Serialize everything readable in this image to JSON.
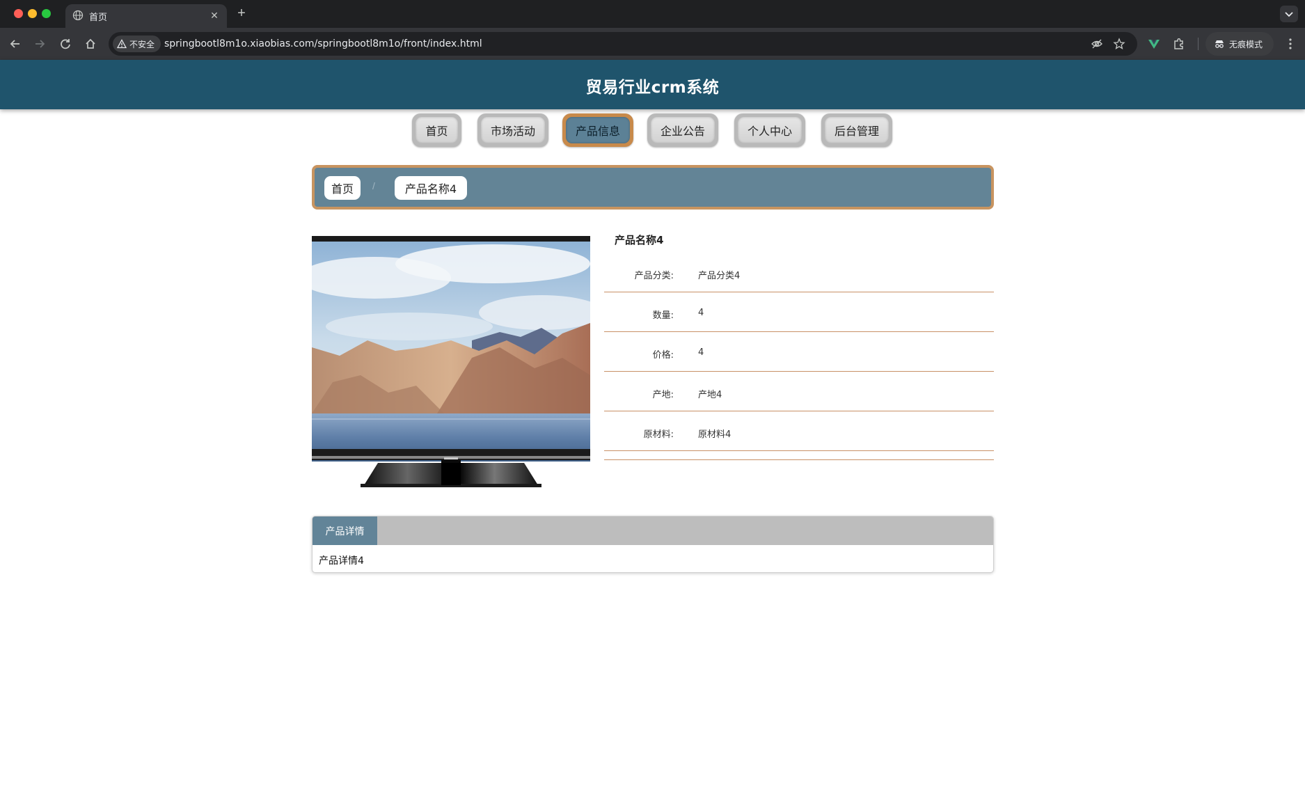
{
  "browser": {
    "tab_title": "首页",
    "security_label": "不安全",
    "url": "springbootl8m1o.xiaobias.com/springbootl8m1o/front/index.html",
    "incognito_label": "无痕模式"
  },
  "site": {
    "title": "贸易行业crm系统"
  },
  "nav": {
    "items": [
      {
        "label": "首页"
      },
      {
        "label": "市场活动"
      },
      {
        "label": "产品信息"
      },
      {
        "label": "企业公告"
      },
      {
        "label": "个人中心"
      },
      {
        "label": "后台管理"
      }
    ],
    "active": "产品信息"
  },
  "breadcrumb": {
    "home": "首页",
    "separator": "/",
    "current": "产品名称4"
  },
  "product": {
    "name": "产品名称4",
    "fields": [
      {
        "label": "产品分类:",
        "value": "产品分类4"
      },
      {
        "label": "数量:",
        "value": "4"
      },
      {
        "label": "价格:",
        "value": "4"
      },
      {
        "label": "产地:",
        "value": "产地4"
      },
      {
        "label": "原材料:",
        "value": "原材料4"
      }
    ]
  },
  "detail": {
    "tab_label": "产品详情",
    "content": "产品详情4"
  },
  "colors": {
    "header": "#1f546c",
    "accent_orange": "#c89460",
    "breadcrumb_bg": "#638496",
    "active_tab": "#628498"
  }
}
